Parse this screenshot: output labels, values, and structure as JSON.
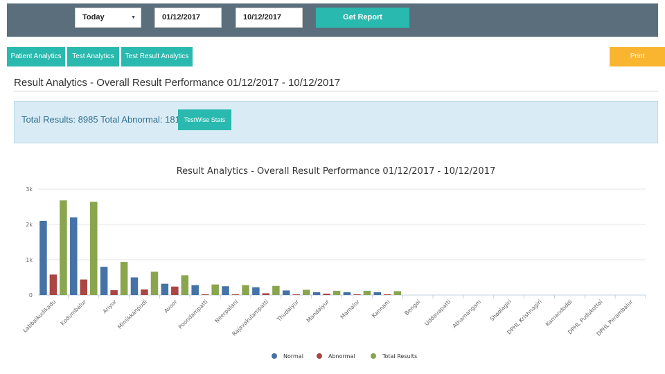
{
  "toolbar": {
    "period_select": "Today",
    "from_date": "01/12/2017",
    "to_date": "10/12/2017",
    "get_report_label": "Get Report"
  },
  "tabs": [
    {
      "label": "Patient Analytics"
    },
    {
      "label": "Test Analytics"
    },
    {
      "label": "Test Result Analytics"
    }
  ],
  "print_label": "Print",
  "page_title": "Result Analytics - Overall Result Performance 01/12/2017 - 10/12/2017",
  "stats": {
    "text": "Total Results: 8985 Total Abnormal: 1818",
    "button_label": "TestWise Stats"
  },
  "colors": {
    "normal": "#4572a7",
    "abnormal": "#aa4643",
    "total": "#89a54e",
    "accent": "#2ab9ae",
    "print": "#f9b430",
    "topbar": "#5a6f7b"
  },
  "chart_data": {
    "type": "bar",
    "title": "Result Analytics - Overall Result Performance 01/12/2017 - 10/12/2017",
    "xlabel": "",
    "ylabel": "",
    "ylim": [
      0,
      3000
    ],
    "yticks": [
      "0",
      "1k",
      "2k",
      "3k"
    ],
    "ytick_values": [
      0,
      1000,
      2000,
      3000
    ],
    "grid": true,
    "legend_position": "bottom-center",
    "categories": [
      "Labbaikudikadu",
      "Kodumbalur",
      "Ariyur",
      "Mimikkanpudi",
      "Avoor",
      "Poondampatti",
      "Neerpalani",
      "Rajavakulampatti",
      "Thudaiyur",
      "Mandaiyur",
      "Mamalur",
      "Kannam",
      "Bengai",
      "Uddavapatti",
      "Athamangam",
      "Shoolagiri",
      "DPHL Krishnagiri",
      "Kamandoddi",
      "DPHL Pudukottai",
      "DPHL Perambalur"
    ],
    "series": [
      {
        "name": "Normal",
        "values": [
          2100,
          2200,
          800,
          500,
          320,
          280,
          250,
          220,
          130,
          80,
          80,
          80,
          0,
          0,
          0,
          0,
          0,
          0,
          0,
          0
        ]
      },
      {
        "name": "Abnormal",
        "values": [
          580,
          440,
          140,
          160,
          240,
          20,
          20,
          50,
          20,
          40,
          20,
          20,
          0,
          0,
          0,
          0,
          0,
          0,
          0,
          0
        ]
      },
      {
        "name": "Total Results",
        "values": [
          2680,
          2640,
          940,
          660,
          560,
          300,
          280,
          260,
          150,
          120,
          120,
          110,
          0,
          0,
          0,
          0,
          0,
          0,
          0,
          0
        ]
      }
    ]
  }
}
